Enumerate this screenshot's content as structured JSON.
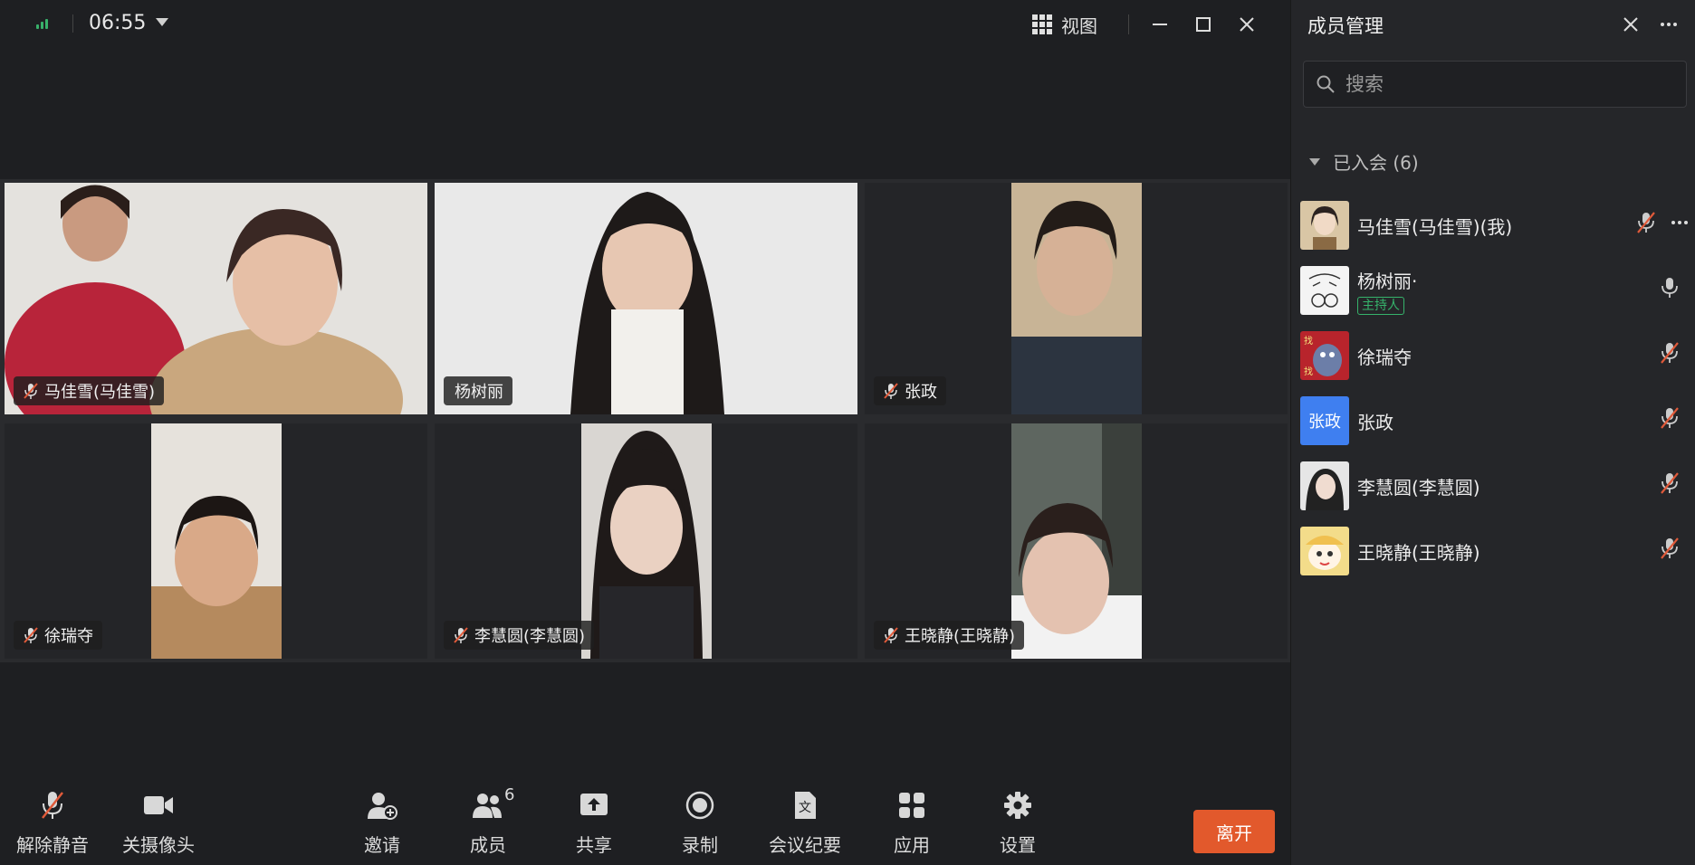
{
  "topbar": {
    "time": "06:55",
    "view_label": "视图"
  },
  "tiles": [
    {
      "name": "马佳雪(马佳雪)",
      "muted": true
    },
    {
      "name": "杨树丽",
      "muted": false
    },
    {
      "name": "张政",
      "muted": true
    },
    {
      "name": "徐瑞夺",
      "muted": true
    },
    {
      "name": "李慧圆(李慧圆)",
      "muted": true
    },
    {
      "name": "王晓静(王晓静)",
      "muted": true
    }
  ],
  "toolbar": {
    "unmute": "解除静音",
    "camera_off": "关摄像头",
    "invite": "邀请",
    "members": "成员",
    "members_count": "6",
    "share": "共享",
    "record": "录制",
    "minutes": "会议纪要",
    "apps": "应用",
    "settings": "设置",
    "leave": "离开"
  },
  "panel": {
    "title": "成员管理",
    "search_placeholder": "搜索",
    "section_label": "已入会 (6)",
    "members": [
      {
        "name": "马佳雪(马佳雪)(我)",
        "mic": "muted"
      },
      {
        "name": "杨树丽·",
        "badge": "主持人",
        "mic": "on"
      },
      {
        "name": "徐瑞夺",
        "mic": "muted"
      },
      {
        "name": "张政",
        "avatar_text": "张政",
        "mic": "muted"
      },
      {
        "name": "李慧圆(李慧圆)",
        "mic": "muted"
      },
      {
        "name": "王晓静(王晓静)",
        "mic": "muted"
      }
    ]
  },
  "colors": {
    "leave_button": "#e2592c",
    "host_badge": "#36b36b",
    "signal": "#38b06a",
    "avatar_zhangzheng": "#3f7ff0",
    "mute_slash": "#e05a3a"
  }
}
